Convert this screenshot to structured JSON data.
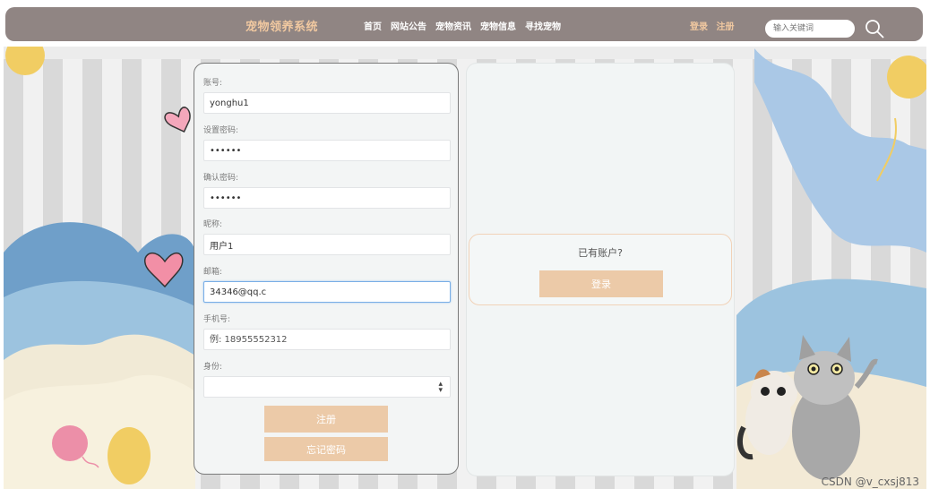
{
  "header": {
    "brand": "宠物领养系统",
    "nav": [
      "首页",
      "网站公告",
      "宠物资讯",
      "宠物信息",
      "寻找宠物"
    ],
    "login_link": "登录",
    "register_link": "注册",
    "search_placeholder": "输入关键词"
  },
  "form": {
    "account_label": "账号:",
    "account_value": "yonghu1",
    "password_label": "设置密码:",
    "password_value": "••••••",
    "confirm_label": "确认密码:",
    "confirm_value": "••••••",
    "nickname_label": "昵称:",
    "nickname_value": "用户1",
    "email_label": "邮箱:",
    "email_value": "34346@qq.c",
    "phone_label": "手机号:",
    "phone_placeholder": "例: 18955552312",
    "identity_label": "身份:",
    "identity_value": "",
    "register_button": "注册",
    "forgot_button": "忘记密码"
  },
  "side": {
    "question": "已有账户?",
    "login_button": "登录"
  },
  "watermark": "CSDN @v_cxsj813",
  "colors": {
    "header_bg": "#908583",
    "brand": "#f0c8a0",
    "button_bg": "#eccaa8",
    "focus_border": "#79aee6"
  },
  "icons": [
    "search-icon",
    "heart-icon",
    "yarn-ball-icon",
    "cats-illustration"
  ]
}
